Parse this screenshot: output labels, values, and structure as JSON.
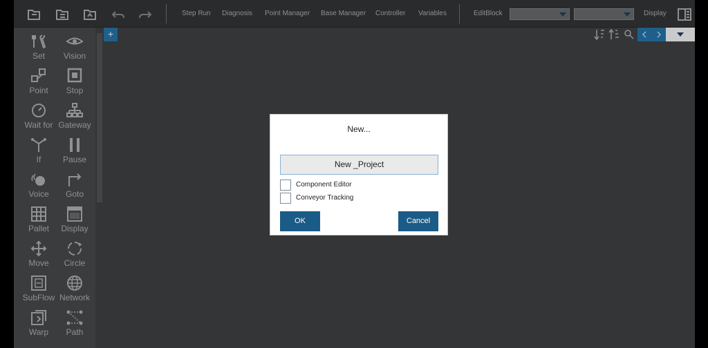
{
  "toolbar": {
    "icons": [
      "new-file-icon",
      "open-file-icon",
      "save-file-icon",
      "undo-icon",
      "redo-icon"
    ],
    "menu": [
      "Step Run",
      "Diagnosis",
      "Point Manager",
      "Base Manager",
      "Controller",
      "Variables"
    ],
    "editblock_label": "EditBlock",
    "display_label": "Display",
    "select1_value": "",
    "select2_value": ""
  },
  "tools": [
    {
      "label": "Set",
      "icon": "wrench-icon"
    },
    {
      "label": "Vision",
      "icon": "eye-icon"
    },
    {
      "label": "Point",
      "icon": "point-icon"
    },
    {
      "label": "Stop",
      "icon": "stop-icon"
    },
    {
      "label": "Wait for",
      "icon": "clock-icon"
    },
    {
      "label": "Gateway",
      "icon": "gateway-icon"
    },
    {
      "label": "If",
      "icon": "if-icon"
    },
    {
      "label": "Pause",
      "icon": "pause-icon"
    },
    {
      "label": "Voice",
      "icon": "voice-icon"
    },
    {
      "label": "Goto",
      "icon": "goto-icon"
    },
    {
      "label": "Pallet",
      "icon": "pallet-icon"
    },
    {
      "label": "Display",
      "icon": "display-icon"
    },
    {
      "label": "Move",
      "icon": "move-icon"
    },
    {
      "label": "Circle",
      "icon": "circle-icon"
    },
    {
      "label": "SubFlow",
      "icon": "subflow-icon"
    },
    {
      "label": "Network",
      "icon": "network-icon"
    },
    {
      "label": "Warp",
      "icon": "warp-icon"
    },
    {
      "label": "Path",
      "icon": "path-icon"
    }
  ],
  "canvas": {
    "add_label": "+"
  },
  "dialog": {
    "title": "New...",
    "input_value": "New _Project",
    "checkbox1": "Component Editor",
    "checkbox2": "Conveyor Tracking",
    "ok": "OK",
    "cancel": "Cancel"
  }
}
